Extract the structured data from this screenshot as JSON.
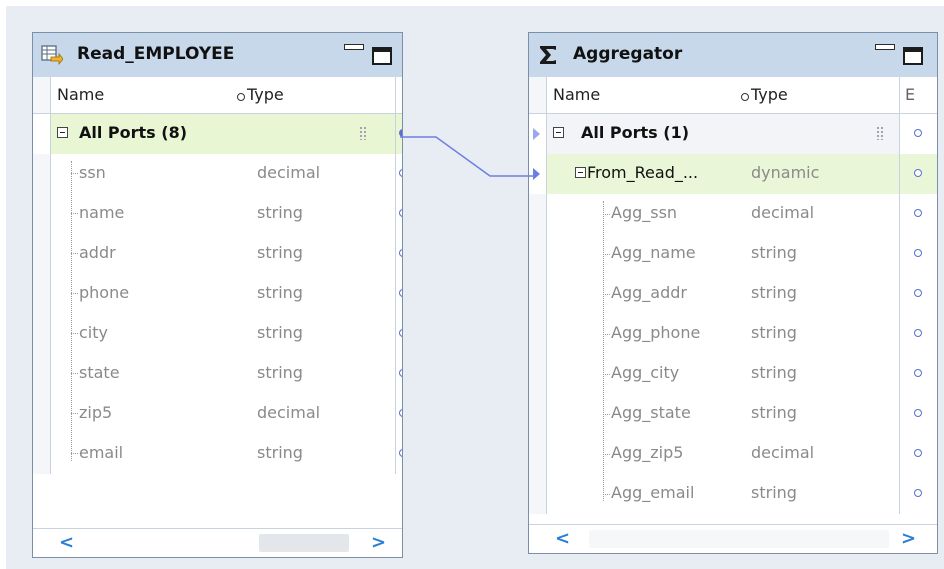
{
  "canvas": {
    "background": "#e8ecf3"
  },
  "left_panel": {
    "title": "Read_EMPLOYEE",
    "icon": "source-table-icon",
    "columns": {
      "name": "Name",
      "type": "Type"
    },
    "group": {
      "label": "All Ports (8)"
    },
    "ports": [
      {
        "name": "ssn",
        "type": "decimal"
      },
      {
        "name": "name",
        "type": "string"
      },
      {
        "name": "addr",
        "type": "string"
      },
      {
        "name": "phone",
        "type": "string"
      },
      {
        "name": "city",
        "type": "string"
      },
      {
        "name": "state",
        "type": "string"
      },
      {
        "name": "zip5",
        "type": "decimal"
      },
      {
        "name": "email",
        "type": "string"
      }
    ],
    "scroll_left": "<",
    "scroll_right": ">"
  },
  "right_panel": {
    "title": "Aggregator",
    "icon": "sigma-icon",
    "columns": {
      "name": "Name",
      "type": "Type",
      "extra": "E"
    },
    "group": {
      "label": "All Ports (1)"
    },
    "dynamic_port": {
      "name": "From_Read_...",
      "type": "dynamic"
    },
    "ports": [
      {
        "name": "Agg_ssn",
        "type": "decimal"
      },
      {
        "name": "Agg_name",
        "type": "string"
      },
      {
        "name": "Agg_addr",
        "type": "string"
      },
      {
        "name": "Agg_phone",
        "type": "string"
      },
      {
        "name": "Agg_city",
        "type": "string"
      },
      {
        "name": "Agg_state",
        "type": "string"
      },
      {
        "name": "Agg_zip5",
        "type": "decimal"
      },
      {
        "name": "Agg_email",
        "type": "string"
      }
    ],
    "scroll_left": "<",
    "scroll_right": ">"
  },
  "colors": {
    "title_bar": "#c7d8ea",
    "group_row": "#e9f6d4",
    "port_circle": "#5a6fd0",
    "link_line": "#6a7ee6",
    "scroll_arrow": "#2a7fd4"
  }
}
